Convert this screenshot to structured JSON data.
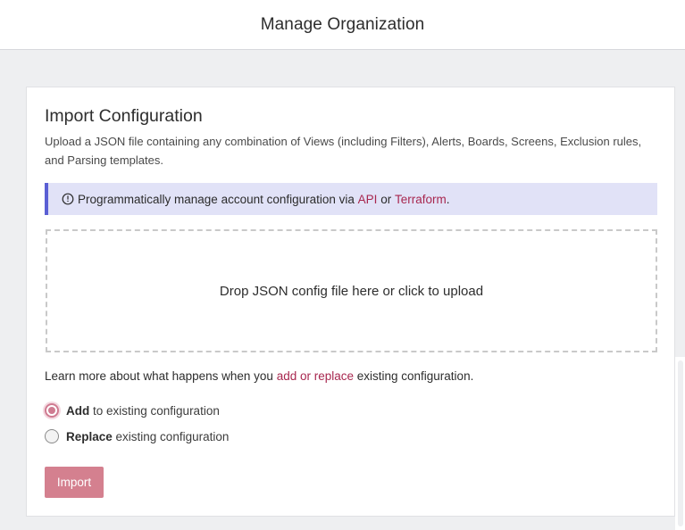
{
  "header": {
    "title": "Manage Organization"
  },
  "card": {
    "title": "Import Configuration",
    "description": "Upload a JSON file containing any combination of Views (including Filters), Alerts, Boards, Screens, Exclusion rules, and Parsing templates."
  },
  "info_banner": {
    "icon": "info-circle-icon",
    "text_before": "Programmatically manage account configuration via ",
    "link_api": "API",
    "text_middle": " or ",
    "link_terraform": "Terraform",
    "text_after": "."
  },
  "dropzone": {
    "text": "Drop JSON config file here or click to upload"
  },
  "learn_more": {
    "text_before": "Learn more about what happens when you ",
    "link": "add or replace",
    "text_after": " existing configuration."
  },
  "options": {
    "add": {
      "bold": "Add",
      "rest": " to existing configuration",
      "selected": true
    },
    "replace": {
      "bold": "Replace",
      "rest": " existing configuration",
      "selected": false
    }
  },
  "actions": {
    "import_label": "Import"
  },
  "colors": {
    "accent": "#a8274f",
    "button": "#d4808f",
    "banner_bg": "#e1e2f7",
    "banner_border": "#5a5fd4",
    "page_bg": "#eeeff1"
  }
}
